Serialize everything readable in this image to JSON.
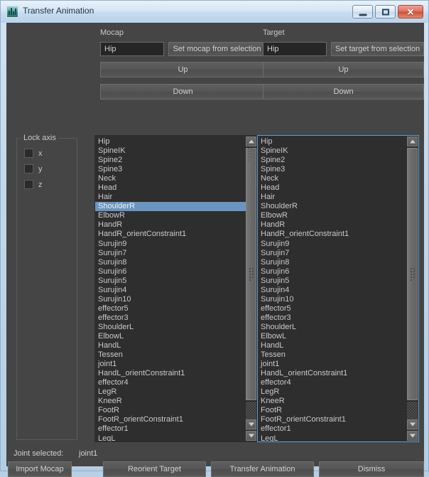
{
  "window": {
    "title": "Transfer Animation",
    "icon": "maya-app-icon",
    "controls": {
      "minimize": "minimize-icon",
      "maximize": "maximize-icon",
      "close": "✕"
    },
    "frame_color": "#b3cde3",
    "client_color": "#454545"
  },
  "mocap": {
    "group_label": "Mocap",
    "field_value": "Hip",
    "set_button": "Set mocap from selection",
    "up_button": "Up",
    "down_button": "Down"
  },
  "target": {
    "group_label": "Target",
    "field_value": "Hip",
    "set_button": "Set target from selection",
    "up_button": "Up",
    "down_button": "Down"
  },
  "lock_axis": {
    "title": "Lock axis",
    "items": [
      {
        "label": "x",
        "checked": false
      },
      {
        "label": "y",
        "checked": false
      },
      {
        "label": "z",
        "checked": false
      }
    ]
  },
  "mocap_list": {
    "focused": false,
    "selected": "ShoulderR",
    "selection_color": "#6a95c0",
    "items": [
      "Hip",
      "SpineIK",
      "Spine2",
      "Spine3",
      "Neck",
      "Head",
      "Hair",
      "ShoulderR",
      "ElbowR",
      "HandR",
      "HandR_orientConstraint1",
      "Surujin9",
      "Surujin7",
      "Surujin8",
      "Surujin6",
      "Surujin5",
      "Surujin4",
      "Surujin10",
      "effector5",
      "effector3",
      "ShoulderL",
      "ElbowL",
      "HandL",
      "Tessen",
      "joint1",
      "HandL_orientConstraint1",
      "effector4",
      "LegR",
      "KneeR",
      "FootR",
      "FootR_orientConstraint1",
      "effector1",
      "LegL"
    ]
  },
  "target_list": {
    "focused": true,
    "focus_border_color": "#5a9fd4",
    "selected": null,
    "items": [
      "Hip",
      "SpineIK",
      "Spine2",
      "Spine3",
      "Neck",
      "Head",
      "Hair",
      "ShoulderR",
      "ElbowR",
      "HandR",
      "HandR_orientConstraint1",
      "Surujin9",
      "Surujin7",
      "Surujin8",
      "Surujin6",
      "Surujin5",
      "Surujin4",
      "Surujin10",
      "effector5",
      "effector3",
      "ShoulderL",
      "ElbowL",
      "HandL",
      "Tessen",
      "joint1",
      "HandL_orientConstraint1",
      "effector4",
      "LegR",
      "KneeR",
      "FootR",
      "FootR_orientConstraint1",
      "effector1",
      "LegL"
    ]
  },
  "status": {
    "label": "Joint selected:",
    "value": "joint1"
  },
  "bottom_buttons": {
    "import_mocap": "Import Mocap",
    "reorient_target": "Reorient Target",
    "transfer_animation": "Transfer Animation",
    "dismiss": "Dismiss"
  }
}
